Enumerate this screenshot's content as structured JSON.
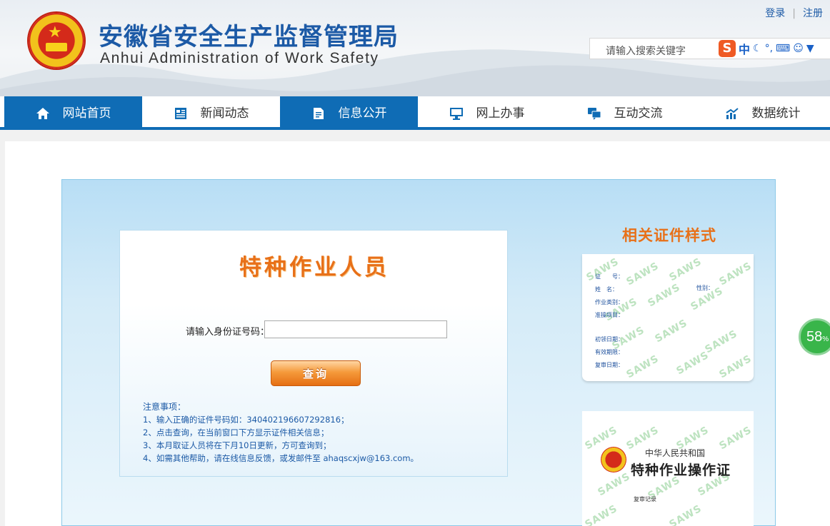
{
  "header": {
    "title_cn": "安徽省安全生产监督管理局",
    "title_en": "Anhui Administration of Work Safety",
    "login": "登录",
    "register": "注册",
    "search_placeholder": "请输入搜索关键字",
    "ime_logo": "S",
    "ime_lang": "中"
  },
  "nav": {
    "items": [
      {
        "label": "网站首页",
        "icon": "home-icon"
      },
      {
        "label": "新闻动态",
        "icon": "news-icon"
      },
      {
        "label": "信息公开",
        "icon": "document-icon"
      },
      {
        "label": "网上办事",
        "icon": "monitor-icon"
      },
      {
        "label": "互动交流",
        "icon": "chat-icon"
      },
      {
        "label": "数据统计",
        "icon": "chart-icon"
      }
    ],
    "active": [
      "网站首页",
      "信息公开"
    ]
  },
  "form": {
    "title": "特种作业人员",
    "id_label": "请输入身份证号码：",
    "id_value": "",
    "query_button": "查询",
    "notes_title": "注意事项：",
    "notes": [
      "1、输入正确的证件号码如：340402196607292816；",
      "2、点击查询，在当前窗口下方显示证件相关信息；",
      "3、本月取证人员将在下月10日更新，方可查询到；",
      "4、如需其他帮助，请在线信息反馈，或发邮件至 ahaqscxjw@163.com。"
    ]
  },
  "side": {
    "title": "相关证件样式",
    "cert1_fields": [
      "证　　号：",
      "姓　名：",
      "性别：",
      "作业类别：",
      "准操项目：",
      "初领日期：",
      "有效期限：",
      "复审日期："
    ],
    "watermark": "SAWS",
    "cert2_sub": "中华人民共和国",
    "cert2_title": "特种作业操作证",
    "cert2_record": "复审记录"
  },
  "badge": {
    "value": "58",
    "unit": "%"
  },
  "colors": {
    "brand_blue": "#0f6cb5",
    "accent_orange": "#e87018",
    "link_blue": "#1c5aa6",
    "badge_green": "#39b54a"
  }
}
